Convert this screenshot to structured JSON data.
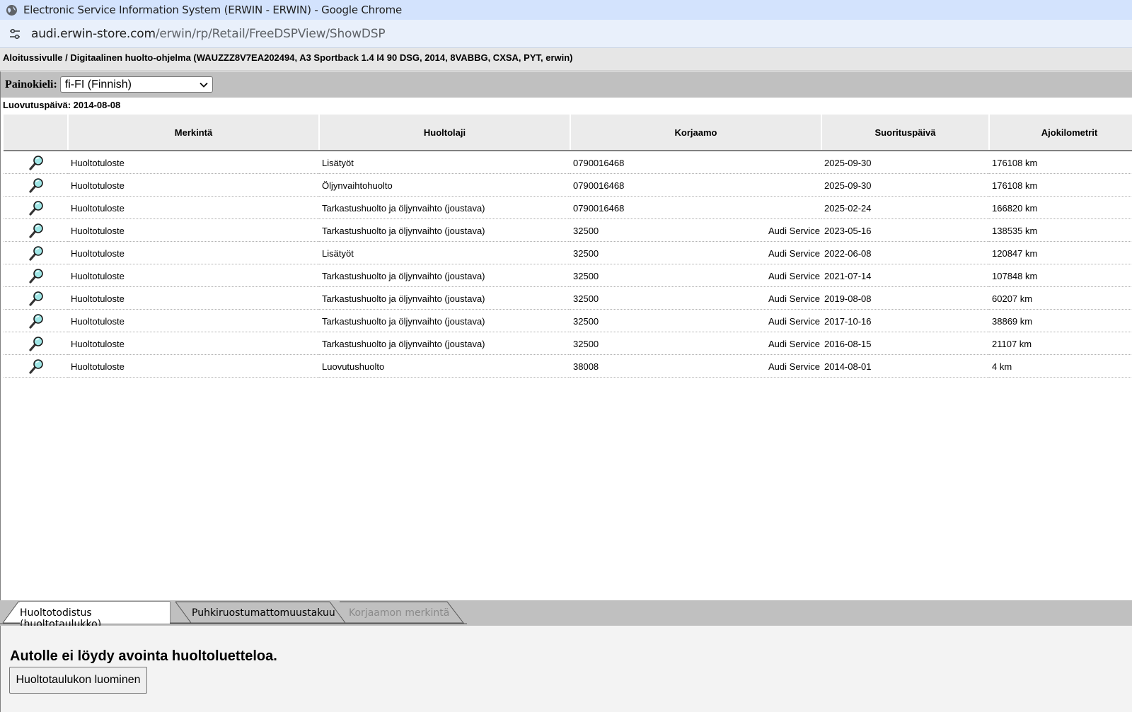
{
  "browser": {
    "window_title": "Electronic Service Information System (ERWIN - ERWIN) - Google Chrome",
    "url_host": "audi.erwin-store.com",
    "url_path": "/erwin/rp/Retail/FreeDSPView/ShowDSP"
  },
  "breadcrumb": "Aloitussivulle / Digitaalinen huolto-ohjelma (WAUZZZ8V7EA202494, A3 Sportback 1.4 I4 90 DSG, 2014, 8VABBG, CXSA, PYT, erwin)",
  "language": {
    "label": "Painokieli:",
    "selected": "fi-FI (Finnish)"
  },
  "handover_date": "Luovutuspäivä: 2014-08-08",
  "table": {
    "headers": [
      "",
      "Merkintä",
      "Huoltolaji",
      "Korjaamo",
      "Suorituspäivä",
      "Ajokilometrit"
    ],
    "rows": [
      {
        "merkinta": "Huoltotuloste",
        "huoltolaji": "Lisätyöt",
        "korjaamo_id": "0790016468",
        "korjaamo_name": "",
        "date": "2025-09-30",
        "km": "176108 km"
      },
      {
        "merkinta": "Huoltotuloste",
        "huoltolaji": "Öljynvaihtohuolto",
        "korjaamo_id": "0790016468",
        "korjaamo_name": "",
        "date": "2025-09-30",
        "km": "176108 km"
      },
      {
        "merkinta": "Huoltotuloste",
        "huoltolaji": "Tarkastushuolto ja öljynvaihto (joustava)",
        "korjaamo_id": "0790016468",
        "korjaamo_name": "",
        "date": "2025-02-24",
        "km": "166820 km"
      },
      {
        "merkinta": "Huoltotuloste",
        "huoltolaji": "Tarkastushuolto ja öljynvaihto (joustava)",
        "korjaamo_id": "32500",
        "korjaamo_name": "Audi Service",
        "date": "2023-05-16",
        "km": "138535 km"
      },
      {
        "merkinta": "Huoltotuloste",
        "huoltolaji": "Lisätyöt",
        "korjaamo_id": "32500",
        "korjaamo_name": "Audi Service",
        "date": "2022-06-08",
        "km": "120847 km"
      },
      {
        "merkinta": "Huoltotuloste",
        "huoltolaji": "Tarkastushuolto ja öljynvaihto (joustava)",
        "korjaamo_id": "32500",
        "korjaamo_name": "Audi Service",
        "date": "2021-07-14",
        "km": "107848 km"
      },
      {
        "merkinta": "Huoltotuloste",
        "huoltolaji": "Tarkastushuolto ja öljynvaihto (joustava)",
        "korjaamo_id": "32500",
        "korjaamo_name": "Audi Service",
        "date": "2019-08-08",
        "km": "60207 km"
      },
      {
        "merkinta": "Huoltotuloste",
        "huoltolaji": "Tarkastushuolto ja öljynvaihto (joustava)",
        "korjaamo_id": "32500",
        "korjaamo_name": "Audi Service",
        "date": "2017-10-16",
        "km": "38869 km"
      },
      {
        "merkinta": "Huoltotuloste",
        "huoltolaji": "Tarkastushuolto ja öljynvaihto (joustava)",
        "korjaamo_id": "32500",
        "korjaamo_name": "Audi Service",
        "date": "2016-08-15",
        "km": "21107 km"
      },
      {
        "merkinta": "Huoltotuloste",
        "huoltolaji": "Luovutushuolto",
        "korjaamo_id": "38008",
        "korjaamo_name": "Audi Service",
        "date": "2014-08-01",
        "km": "4 km"
      }
    ]
  },
  "tabs": [
    {
      "label": "Huoltotodistus (huoltotaulukko)",
      "state": "active"
    },
    {
      "label": "Puhkiruostumattomuustakuu",
      "state": "normal"
    },
    {
      "label": "Korjaamon merkintä",
      "state": "disabled"
    }
  ],
  "panel": {
    "message": "Autolle ei löydy avointa huoltoluetteloa.",
    "button_label": "Huoltotaulukon luominen"
  },
  "colors": {
    "chrome_titlebar": "#d3e3fd",
    "header_bg": "#ebebeb",
    "grey_bar": "#c0c0c0",
    "magnifier_lens": "#9fe6e6"
  }
}
